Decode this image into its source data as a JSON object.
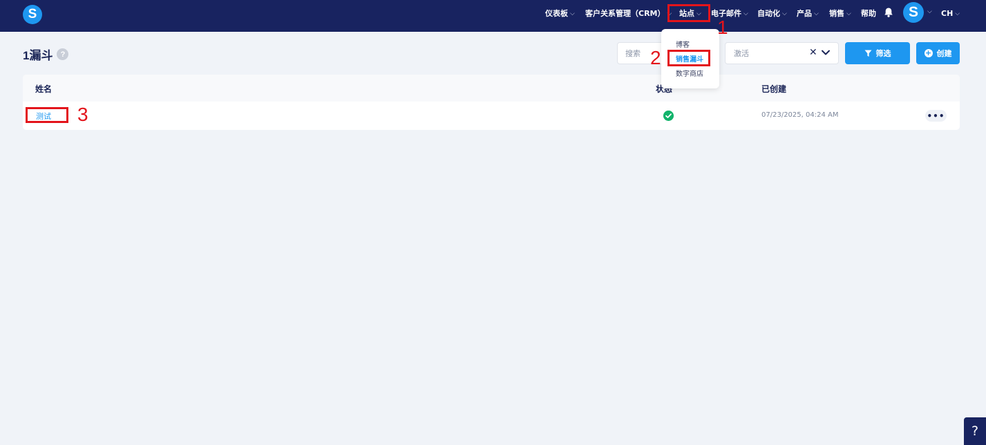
{
  "nav": {
    "logo": "S",
    "items": [
      {
        "label": "仪表板",
        "chevron": "⌵"
      },
      {
        "label": "客户关系管理（CRM）",
        "chevron": "⌵"
      },
      {
        "label": "站点",
        "chevron": "⌵"
      },
      {
        "label": "电子邮件",
        "chevron": "⌵"
      },
      {
        "label": "自动化",
        "chevron": "⌵"
      },
      {
        "label": "产品",
        "chevron": "⌵"
      },
      {
        "label": "销售",
        "chevron": "⌵"
      },
      {
        "label": "帮助",
        "chevron": ""
      }
    ],
    "avatar": "S",
    "lang": "CH",
    "avatar_chevron": "⌵",
    "lang_chevron": "⌵"
  },
  "page": {
    "title": "1漏斗",
    "help": "?"
  },
  "toolbar": {
    "search_placeholder": "搜索",
    "status_value": "激活",
    "clear": "✕",
    "filter_label": "筛选",
    "create_label": "创建",
    "plus": "+"
  },
  "dropdown": {
    "items": [
      {
        "label": "博客"
      },
      {
        "label": "销售漏斗",
        "active": true
      },
      {
        "label": "数字商店"
      }
    ]
  },
  "table": {
    "columns": [
      "姓名",
      "状态",
      "已创建"
    ],
    "rows": [
      {
        "name": "测试",
        "status": "active",
        "created": "07/23/2025, 04:24 AM",
        "more": "•••"
      }
    ]
  },
  "annotations": [
    "1",
    "2",
    "3"
  ],
  "help_corner": "?",
  "colors": {
    "nav_bg": "#182360",
    "accent": "#1e97f0",
    "success": "#12b36b",
    "annotation": "#e3141b",
    "page_bg": "#f0f3f8"
  }
}
